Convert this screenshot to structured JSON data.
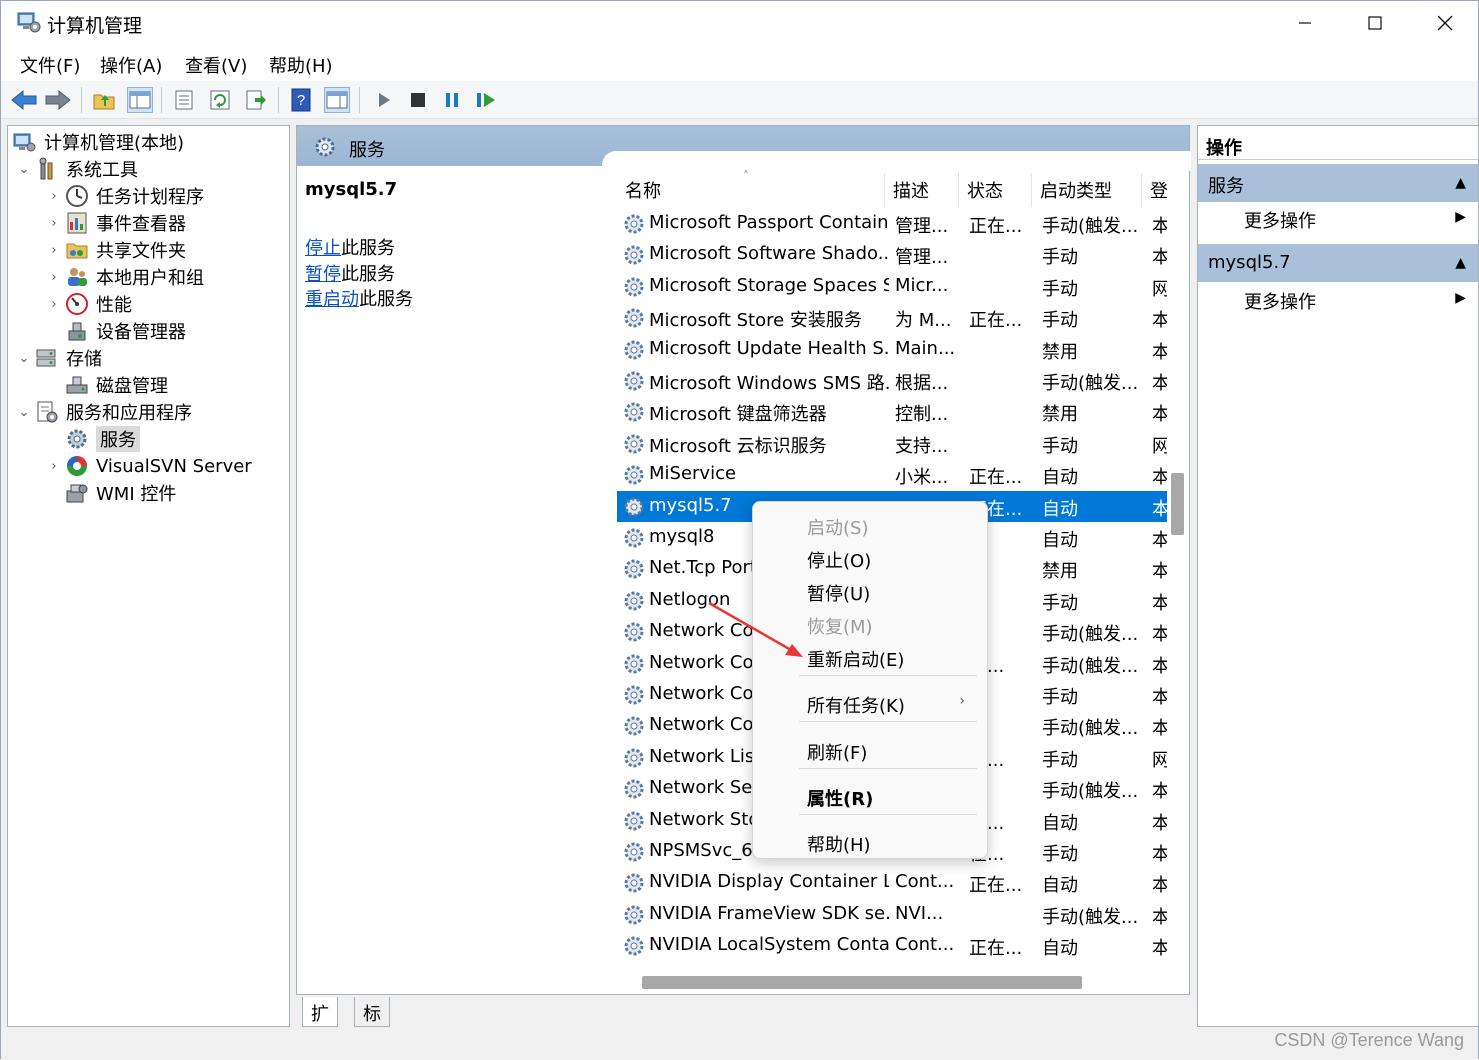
{
  "window": {
    "title": "计算机管理"
  },
  "menu": [
    "文件(F)",
    "操作(A)",
    "查看(V)",
    "帮助(H)"
  ],
  "tree": [
    {
      "label": "计算机管理(本地)",
      "icon": "computer-mgmt-icon"
    },
    {
      "label": "系统工具",
      "icon": "tools-icon"
    },
    {
      "label": "任务计划程序",
      "icon": "clock-icon"
    },
    {
      "label": "事件查看器",
      "icon": "event-viewer-icon"
    },
    {
      "label": "共享文件夹",
      "icon": "shared-folder-icon"
    },
    {
      "label": "本地用户和组",
      "icon": "users-icon"
    },
    {
      "label": "性能",
      "icon": "performance-icon"
    },
    {
      "label": "设备管理器",
      "icon": "device-manager-icon"
    },
    {
      "label": "存储",
      "icon": "storage-icon"
    },
    {
      "label": "磁盘管理",
      "icon": "disk-icon"
    },
    {
      "label": "服务和应用程序",
      "icon": "services-apps-icon"
    },
    {
      "label": "服务",
      "icon": "gear-icon"
    },
    {
      "label": "VisualSVN Server",
      "icon": "visualsvn-icon"
    },
    {
      "label": "WMI 控件",
      "icon": "wmi-icon"
    }
  ],
  "center": {
    "header": "服务",
    "selected_name": "mysql5.7",
    "links": [
      {
        "link": "停止",
        "rest": "此服务"
      },
      {
        "link": "暂停",
        "rest": "此服务"
      },
      {
        "link": "重启动",
        "rest": "此服务"
      }
    ],
    "columns": [
      "名称",
      "描述",
      "状态",
      "启动类型",
      "登"
    ],
    "rows": [
      {
        "name": "Microsoft Passport Container",
        "desc": "管理...",
        "status": "正在...",
        "start": "手动(触发...",
        "logon": "本"
      },
      {
        "name": "Microsoft Software Shado...",
        "desc": "管理...",
        "status": "",
        "start": "手动",
        "logon": "本"
      },
      {
        "name": "Microsoft Storage Spaces S...",
        "desc": "Micr...",
        "status": "",
        "start": "手动",
        "logon": "网"
      },
      {
        "name": "Microsoft Store 安装服务",
        "desc": "为 M...",
        "status": "正在...",
        "start": "手动",
        "logon": "本"
      },
      {
        "name": "Microsoft Update Health S...",
        "desc": "Main...",
        "status": "",
        "start": "禁用",
        "logon": "本"
      },
      {
        "name": "Microsoft Windows SMS 路...",
        "desc": "根据...",
        "status": "",
        "start": "手动(触发...",
        "logon": "本"
      },
      {
        "name": "Microsoft 键盘筛选器",
        "desc": "控制...",
        "status": "",
        "start": "禁用",
        "logon": "本"
      },
      {
        "name": "Microsoft 云标识服务",
        "desc": "支持...",
        "status": "",
        "start": "手动",
        "logon": "网"
      },
      {
        "name": "MiService",
        "desc": "小米...",
        "status": "正在...",
        "start": "自动",
        "logon": "本"
      },
      {
        "name": "mysql5.7",
        "desc": "",
        "status": "正在...",
        "start": "自动",
        "logon": "本"
      },
      {
        "name": "mysql8",
        "desc": "",
        "status": "",
        "start": "自动",
        "logon": "本"
      },
      {
        "name": "Net.Tcp Port",
        "desc": "",
        "status": "",
        "start": "禁用",
        "logon": "本"
      },
      {
        "name": "Netlogon",
        "desc": "",
        "status": "",
        "start": "手动",
        "logon": "本"
      },
      {
        "name": "Network Co",
        "desc": "",
        "status": "",
        "start": "手动(触发...",
        "logon": "本"
      },
      {
        "name": "Network Co",
        "desc": "",
        "status": "在...",
        "start": "手动(触发...",
        "logon": "本"
      },
      {
        "name": "Network Co",
        "desc": "",
        "status": "",
        "start": "手动",
        "logon": "本"
      },
      {
        "name": "Network Co",
        "desc": "",
        "status": "",
        "start": "手动(触发...",
        "logon": "本"
      },
      {
        "name": "Network List",
        "desc": "",
        "status": "在...",
        "start": "手动",
        "logon": "网"
      },
      {
        "name": "Network Set",
        "desc": "",
        "status": "",
        "start": "手动(触发...",
        "logon": "本"
      },
      {
        "name": "Network Sto",
        "desc": "",
        "status": "在...",
        "start": "自动",
        "logon": "本"
      },
      {
        "name": "NPSMSvc_6",
        "desc": "",
        "status": "在...",
        "start": "手动",
        "logon": "本"
      },
      {
        "name": "NVIDIA Display Container LS",
        "desc": "Cont...",
        "status": "正在...",
        "start": "自动",
        "logon": "本"
      },
      {
        "name": "NVIDIA FrameView SDK se...",
        "desc": "NVI...",
        "status": "",
        "start": "手动(触发...",
        "logon": "本"
      },
      {
        "name": "NVIDIA LocalSystem Conta...",
        "desc": "Cont...",
        "status": "正在...",
        "start": "自动",
        "logon": "本"
      }
    ],
    "selected_row": 9,
    "tabs": [
      "扩展",
      "标准"
    ]
  },
  "actions": {
    "title": "操作",
    "sections": [
      {
        "label": "服务",
        "item": "更多操作"
      },
      {
        "label": "mysql5.7",
        "item": "更多操作"
      }
    ]
  },
  "context_menu": {
    "items": [
      {
        "label": "启动(S)",
        "disabled": true
      },
      {
        "label": "停止(O)"
      },
      {
        "label": "暂停(U)"
      },
      {
        "label": "恢复(M)",
        "disabled": true
      },
      {
        "label": "重新启动(E)"
      },
      {
        "label": "所有任务(K)",
        "submenu": true
      },
      {
        "label": "刷新(F)"
      },
      {
        "label": "属性(R)",
        "bold": true
      },
      {
        "label": "帮助(H)"
      }
    ]
  },
  "watermark": "CSDN @Terence Wang",
  "colors": {
    "selection": "#0078d7",
    "pane_header": "#a9c0da",
    "arrow": "#e53935"
  }
}
